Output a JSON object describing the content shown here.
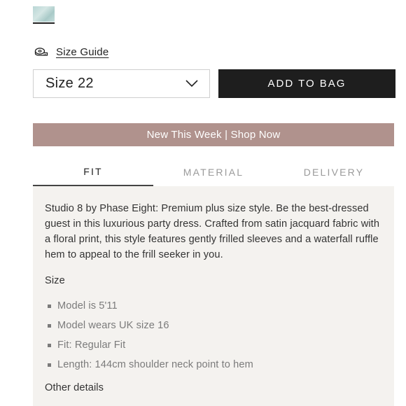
{
  "thumbnail": {
    "name": "color-swatch",
    "color": "#b9d6d5"
  },
  "size_guide": {
    "label": "Size Guide",
    "icon": "measuring-tape-icon"
  },
  "size_select": {
    "value": "Size 22",
    "icon": "chevron-down-icon"
  },
  "add_to_bag": {
    "label": "ADD TO BAG",
    "background": "#1e1e1e"
  },
  "promo": {
    "text": "New This Week | Shop Now",
    "background": "#b0928d"
  },
  "tabs": [
    {
      "label": "FIT",
      "active": true
    },
    {
      "label": "MATERIAL",
      "active": false
    },
    {
      "label": "DELIVERY",
      "active": false
    }
  ],
  "panel": {
    "description": "Studio 8 by Phase Eight: Premium plus size style. Be the best-dressed guest in this luxurious party dress. Crafted from satin jacquard fabric with a floral print, this style features gently frilled sleeves and a waterfall ruffle hem to appeal to the frill seeker in you.",
    "size_heading": "Size",
    "size_items": [
      "Model is 5'11",
      "Model wears UK size 16",
      "Fit: Regular Fit",
      "Length: 144cm shoulder neck point to hem"
    ],
    "other_heading": "Other details",
    "background": "#f4f2ef"
  }
}
